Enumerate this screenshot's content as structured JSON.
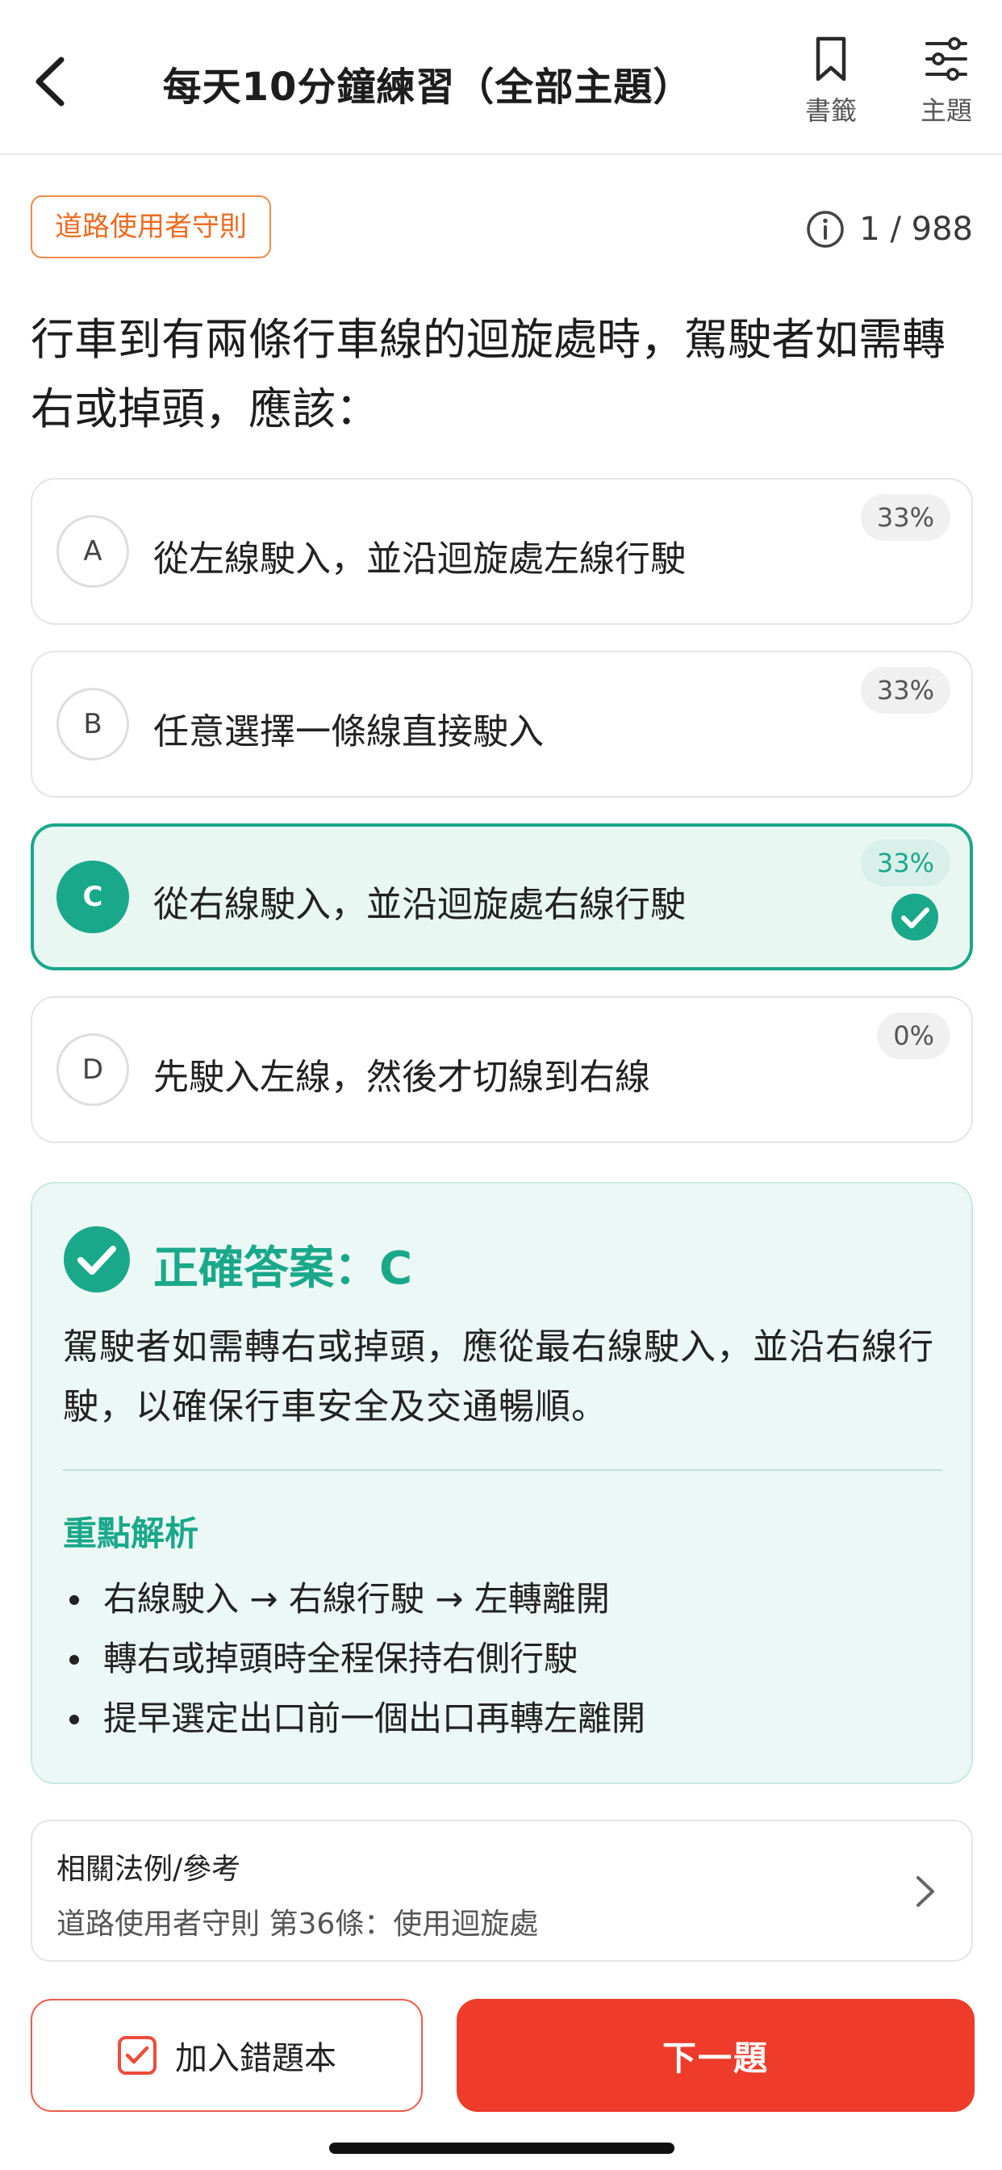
{
  "header": {
    "title": "每天10分鐘練習（全部主題）",
    "bookmark_label": "書籤",
    "topic_label": "主題"
  },
  "topic_tag": "道路使用者守則",
  "counter": "1 / 988",
  "question": "行車到有兩條行車線的迴旋處時，駕駛者如需轉右或掉頭，應該：",
  "options": [
    {
      "letter": "A",
      "text": "從左線駛入，並沿迴旋處左線行駛",
      "percent": "33%"
    },
    {
      "letter": "B",
      "text": "任意選擇一條線直接駛入",
      "percent": "33%"
    },
    {
      "letter": "C",
      "text": "從右線駛入，並沿迴旋處右線行駛",
      "percent": "33%"
    },
    {
      "letter": "D",
      "text": "先駛入左線，然後才切線到右線",
      "percent": "0%"
    }
  ],
  "explanation": {
    "answer_title": "正確答案：C",
    "body": "駕駛者如需轉右或掉頭，應從最右線駛入，並沿右線行駛，以確保行車安全及交通暢順。",
    "key_title": "重點解析",
    "points": [
      "右線駛入 → 右線行駛 → 左轉離開",
      "轉右或掉頭時全程保持右側行駛",
      "提早選定出口前一個出口再轉左離開"
    ]
  },
  "reference": {
    "title": "相關法例/參考",
    "body": "道路使用者守則 第36條：使用迴旋處"
  },
  "buttons": {
    "add_mistake": "加入錯題本",
    "next": "下一題"
  },
  "colors": {
    "accent_green": "#1aa88a",
    "accent_red": "#ee3b2a",
    "tag_orange": "#ee6b21"
  }
}
